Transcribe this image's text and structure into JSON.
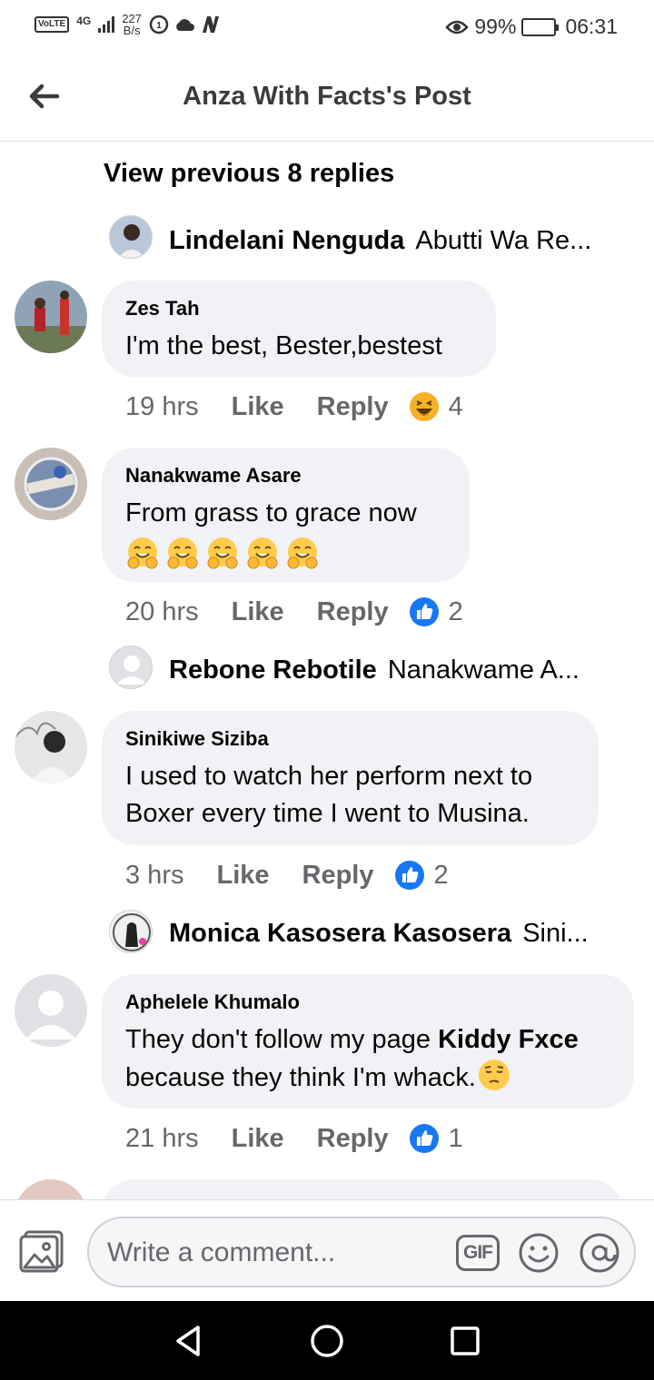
{
  "status_bar": {
    "carrier_tag": "VoLTE",
    "network": "4G",
    "net_speed_value": "227",
    "net_speed_unit": "B/s",
    "battery_percent": "99%",
    "battery_level": 0.99,
    "time": "06:31"
  },
  "header": {
    "title": "Anza With Facts's Post",
    "back_icon": "arrow-left-icon"
  },
  "thread": {
    "view_previous": "View previous 8 replies",
    "items": [
      {
        "kind": "collapsed_reply",
        "author": "Lindelani Nenguda",
        "preview": "Abutti Wa Re..."
      },
      {
        "kind": "comment",
        "author": "Zes Tah",
        "lines": [
          "I'm the best, Bester,bestest"
        ],
        "time": "19 hrs",
        "like_label": "Like",
        "reply_label": "Reply",
        "reaction": "haha",
        "reaction_count": "4"
      },
      {
        "kind": "comment",
        "author": "Nanakwame Asare",
        "lines": [
          "From grass to grace now"
        ],
        "emoji_count": 5,
        "emoji": "hug-face",
        "time": "20 hrs",
        "like_label": "Like",
        "reply_label": "Reply",
        "reaction": "like",
        "reaction_count": "2"
      },
      {
        "kind": "collapsed_reply",
        "author": "Rebone Rebotile",
        "preview": "Nanakwame A..."
      },
      {
        "kind": "comment",
        "author": "Sinikiwe Siziba",
        "lines": [
          "I used to watch her perform next to",
          "Boxer every time I went to Musina."
        ],
        "time": "3 hrs",
        "like_label": "Like",
        "reply_label": "Reply",
        "reaction": "like",
        "reaction_count": "2"
      },
      {
        "kind": "collapsed_reply",
        "author": "Monica Kasosera Kasosera",
        "preview": "Sini..."
      },
      {
        "kind": "comment",
        "author": "Aphelele Khumalo",
        "line1_prefix": "They don't follow my page ",
        "line1_tag": "Kiddy Fxce",
        "line2": "because they think I'm whack.",
        "trailing_emoji": "pensive-face",
        "time": "21 hrs",
        "like_label": "Like",
        "reply_label": "Reply",
        "reaction": "like",
        "reaction_count": "1"
      }
    ]
  },
  "composer": {
    "placeholder": "Write a comment...",
    "gif_label": "GIF"
  },
  "colors": {
    "bubble": "#f0f2f5",
    "secondary_text": "#65676b",
    "like_blue": "#1877f2",
    "haha_yellow": "#f7b125",
    "divider": "#dadde1"
  }
}
